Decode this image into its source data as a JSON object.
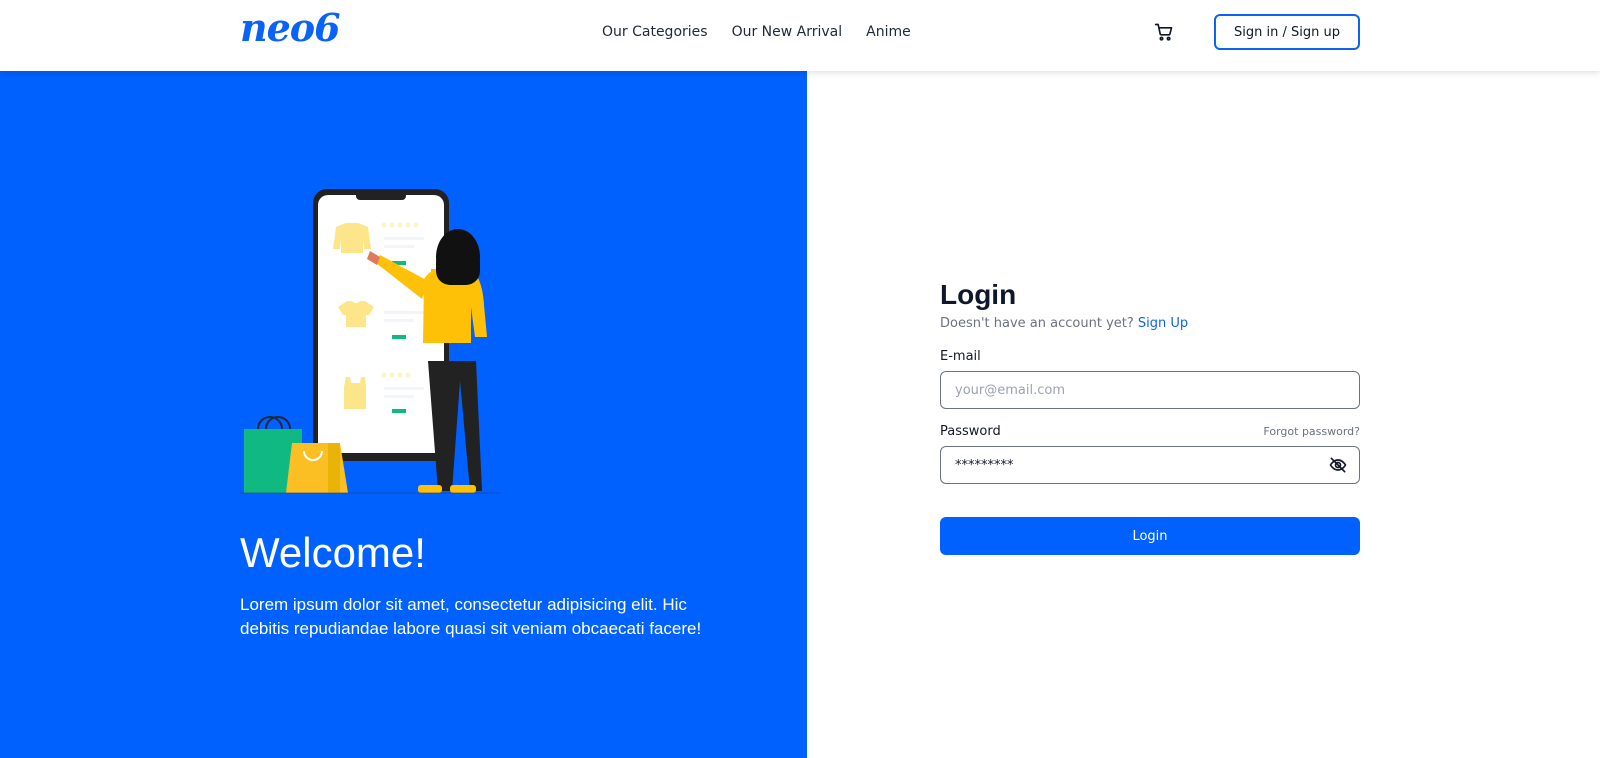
{
  "navbar": {
    "logo": "neo6",
    "links": [
      "Our Categories",
      "Our New Arrival",
      "Anime"
    ],
    "cart_icon": "cart-icon",
    "signin_label": "Sign in / Sign up"
  },
  "hero": {
    "illustration": "woman-shopping-on-phone-illustration",
    "title": "Welcome!",
    "text": "Lorem ipsum dolor sit amet, consectetur adipisicing elit. Hic debitis repudiandae labore quasi sit veniam obcaecati facere!",
    "background_color": "#0061fe"
  },
  "login": {
    "title": "Login",
    "no_account_text": "Doesn't have an account yet?",
    "signup_link": "Sign Up",
    "email_label": "E-mail",
    "email_placeholder": "your@email.com",
    "email_value": "",
    "password_label": "Password",
    "forgot_link": "Forgot password?",
    "password_value": "*********",
    "eye_icon": "eye-off-icon",
    "submit_label": "Login"
  },
  "colors": {
    "accent": "#0b63f6",
    "panel": "#0061fe"
  }
}
